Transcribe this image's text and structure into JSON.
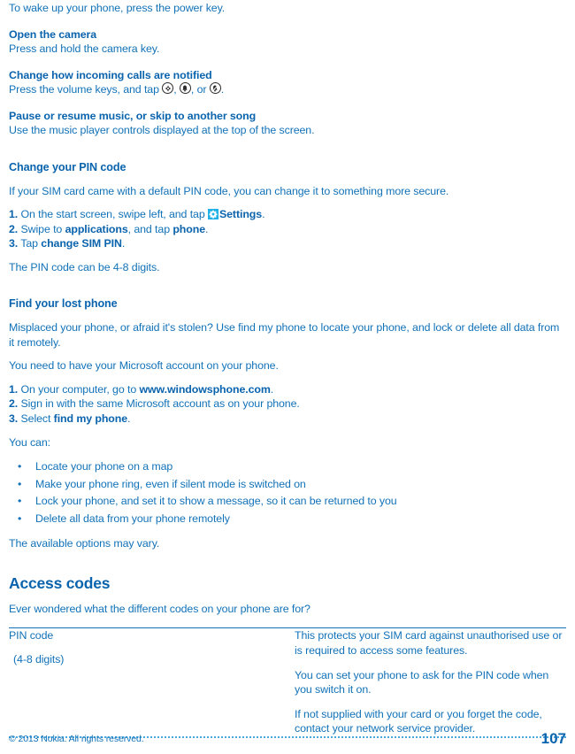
{
  "page": {
    "number": "107",
    "copyright": "© 2013 Nokia. All rights reserved.",
    "accent_color": "#1272b8",
    "heading_color": "#0a63ad",
    "tile_color": "#22b0e8",
    "dotted_rule_color": "#4aa8de"
  },
  "intro": {
    "wake_text": "To wake up your phone, press the power key."
  },
  "tips": [
    {
      "heading": "Open the camera",
      "body": "Press and hold the camera key."
    },
    {
      "heading": "Change how incoming calls are notified",
      "body_prefix": "Press the volume keys, and tap ",
      "sep1": ", ",
      "sep2": ", or ",
      "body_suffix": ".",
      "icons": [
        "vibrate-icon",
        "ring-icon",
        "silent-bell-icon"
      ]
    },
    {
      "heading": "Pause or resume music, or skip to another song",
      "body": "Use the music player controls displayed at the top of the screen."
    }
  ],
  "pin_section": {
    "heading": "Change your PIN code",
    "intro": "If your SIM card came with a default PIN code, you can change it to something more secure.",
    "steps": [
      {
        "num": "1.",
        "pre": " On the start screen, swipe left, and tap ",
        "icon": "settings-gear-icon",
        "bold": "Settings",
        "post": "."
      },
      {
        "num": "2.",
        "pre": " Swipe to ",
        "bold": "applications",
        "mid": ", and tap ",
        "bold2": "phone",
        "post": "."
      },
      {
        "num": "3.",
        "pre": " Tap ",
        "bold": "change SIM PIN",
        "post": "."
      }
    ],
    "note": "The PIN code can be 4-8 digits."
  },
  "find_section": {
    "heading": "Find your lost phone",
    "intro": "Misplaced your phone, or afraid it's stolen? Use find my phone to locate your phone, and lock or delete all data from it remotely.",
    "account_note": "You need to have your Microsoft account on your phone.",
    "steps": [
      {
        "num": "1.",
        "pre": " On your computer, go to ",
        "bold": "www.windowsphone.com",
        "post": "."
      },
      {
        "num": "2.",
        "pre": " Sign in with the same Microsoft account as on your phone.",
        "bold": "",
        "post": ""
      },
      {
        "num": "3.",
        "pre": " Select ",
        "bold": "find my phone",
        "post": "."
      }
    ],
    "you_can_label": "You can:",
    "bullets": [
      "Locate your phone on a map",
      "Make your phone ring, even if silent mode is switched on",
      "Lock your phone, and set it to show a message, so it can be returned to you",
      "Delete all data from your phone remotely"
    ],
    "footnote": "The available options may vary."
  },
  "access_codes": {
    "heading": "Access codes",
    "intro": "Ever wondered what the different codes on your phone are for?",
    "rows": [
      {
        "term": "PIN code",
        "term_sub": "(4-8 digits)",
        "descriptions": [
          "This protects your SIM card against unauthorised use or is required to access some features.",
          "You can set your phone to ask for the PIN code when you switch it on.",
          "If not supplied with your card or you forget the code, contact your network service provider."
        ]
      }
    ]
  }
}
